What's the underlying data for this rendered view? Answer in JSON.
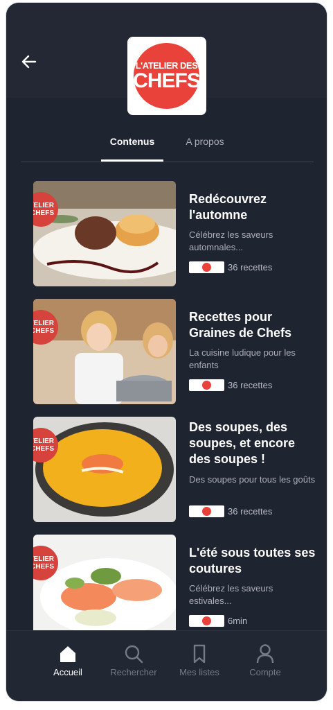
{
  "header": {
    "back_icon": "arrow-left-icon",
    "logo": {
      "line1": "L'ATELIER DES",
      "line2": "CHEFS",
      "color": "#e8423a"
    }
  },
  "tabs": [
    {
      "label": "Contenus",
      "active": true
    },
    {
      "label": "A propos",
      "active": false
    }
  ],
  "collections": [
    {
      "title": "Redécouvrez l'automne",
      "description": "Célébrez les saveurs automnales...",
      "meta": "36 recettes",
      "badge": {
        "line1": "ATELIER",
        "line2": "CHEFS"
      }
    },
    {
      "title": "Recettes pour Graines de Chefs",
      "description": "La cuisine ludique pour les enfants",
      "meta": "36 recettes",
      "badge": {
        "line1": "ATELIER",
        "line2": "CHEFS"
      }
    },
    {
      "title": "Des soupes, des soupes, et encore des soupes !",
      "description": "Des soupes pour tous les goûts",
      "meta": "36 recettes",
      "badge": {
        "line1": "ATELIER",
        "line2": "CHEFS"
      }
    },
    {
      "title": "L'été sous toutes ses coutures",
      "description": "Célébrez les saveurs estivales...",
      "meta": "6min",
      "badge": {
        "line1": "ATELIER",
        "line2": "CHEFS"
      }
    }
  ],
  "bottom_nav": [
    {
      "label": "Accueil",
      "icon": "home-icon",
      "active": true
    },
    {
      "label": "Rechercher",
      "icon": "search-icon",
      "active": false
    },
    {
      "label": "Mes listes",
      "icon": "bookmark-icon",
      "active": false
    },
    {
      "label": "Compte",
      "icon": "user-icon",
      "active": false
    }
  ]
}
